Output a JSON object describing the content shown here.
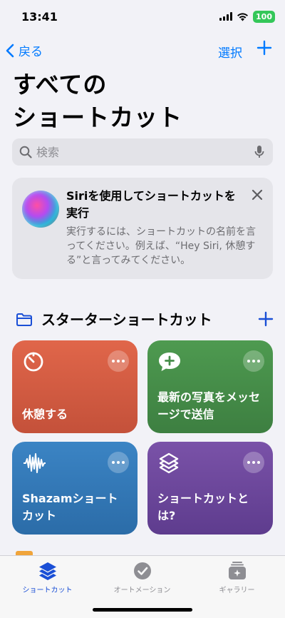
{
  "status_bar": {
    "time": "13:41",
    "battery": "100"
  },
  "nav": {
    "back_label": "戻る",
    "select_label": "選択"
  },
  "title": {
    "line1": "すべての",
    "line2": "ショートカット"
  },
  "search": {
    "placeholder": "検索"
  },
  "siri_card": {
    "title": "Siriを使用してショートカットを実行",
    "body": "実行するには、ショートカットの名前を言ってください。例えば、“Hey Siri, 休憩する”と言ってみてください。"
  },
  "section": {
    "title": "スターターショートカット"
  },
  "tiles": [
    {
      "label": "休憩する",
      "color": "#d55d42",
      "icon": "timer-icon"
    },
    {
      "label": "最新の写真をメッセージで送信",
      "color": "#468d49",
      "icon": "message-plus-icon"
    },
    {
      "label": "Shazamショートカット",
      "color": "#3378b6",
      "icon": "waveform-icon"
    },
    {
      "label": "ショートカットとは?",
      "color": "#6c479b",
      "icon": "shortcuts-stack-icon"
    }
  ],
  "tab_bar": {
    "items": [
      {
        "label": "ショートカット",
        "icon": "shortcuts-icon",
        "active": true
      },
      {
        "label": "オートメーション",
        "icon": "automation-icon",
        "active": false
      },
      {
        "label": "ギャラリー",
        "icon": "gallery-icon",
        "active": false
      }
    ]
  },
  "colors": {
    "accent": "#007aff",
    "tab_active": "#1a4fd6",
    "background": "#f2f2f7"
  }
}
